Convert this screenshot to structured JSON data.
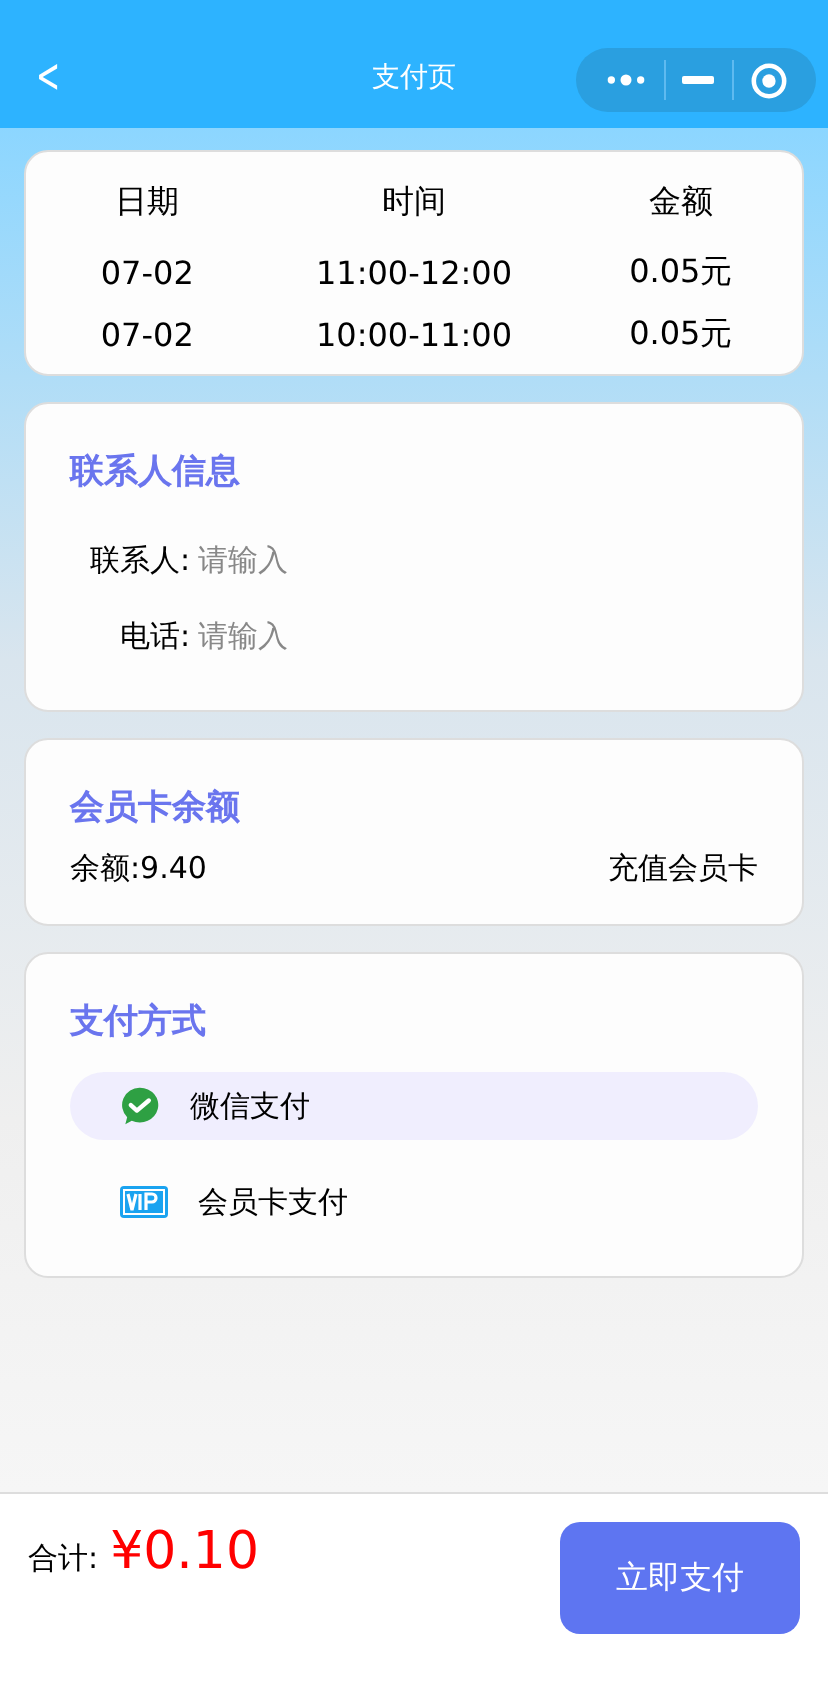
{
  "nav": {
    "title": "支付页",
    "back": "<"
  },
  "table": {
    "columns": [
      "日期",
      "时间",
      "金额"
    ],
    "rows": [
      [
        "07-02",
        "11:00-12:00",
        "0.05元"
      ],
      [
        "07-02",
        "10:00-11:00",
        "0.05元"
      ]
    ]
  },
  "contact": {
    "title": "联系人信息",
    "fields": [
      {
        "label": "联系人:",
        "placeholder": "请输入"
      },
      {
        "label": "电话:",
        "placeholder": "请输入"
      }
    ]
  },
  "member_card": {
    "title": "会员卡余额",
    "balance": "余额:9.40",
    "recharge": "充值会员卡"
  },
  "payment": {
    "title": "支付方式",
    "methods": [
      {
        "kind": "wechat",
        "label": "微信支付",
        "selected": true
      },
      {
        "kind": "vip",
        "label": "会员卡支付",
        "selected": false
      }
    ]
  },
  "footer": {
    "total_label": "合计:",
    "total": "¥0.10",
    "pay_button": "立即支付"
  }
}
